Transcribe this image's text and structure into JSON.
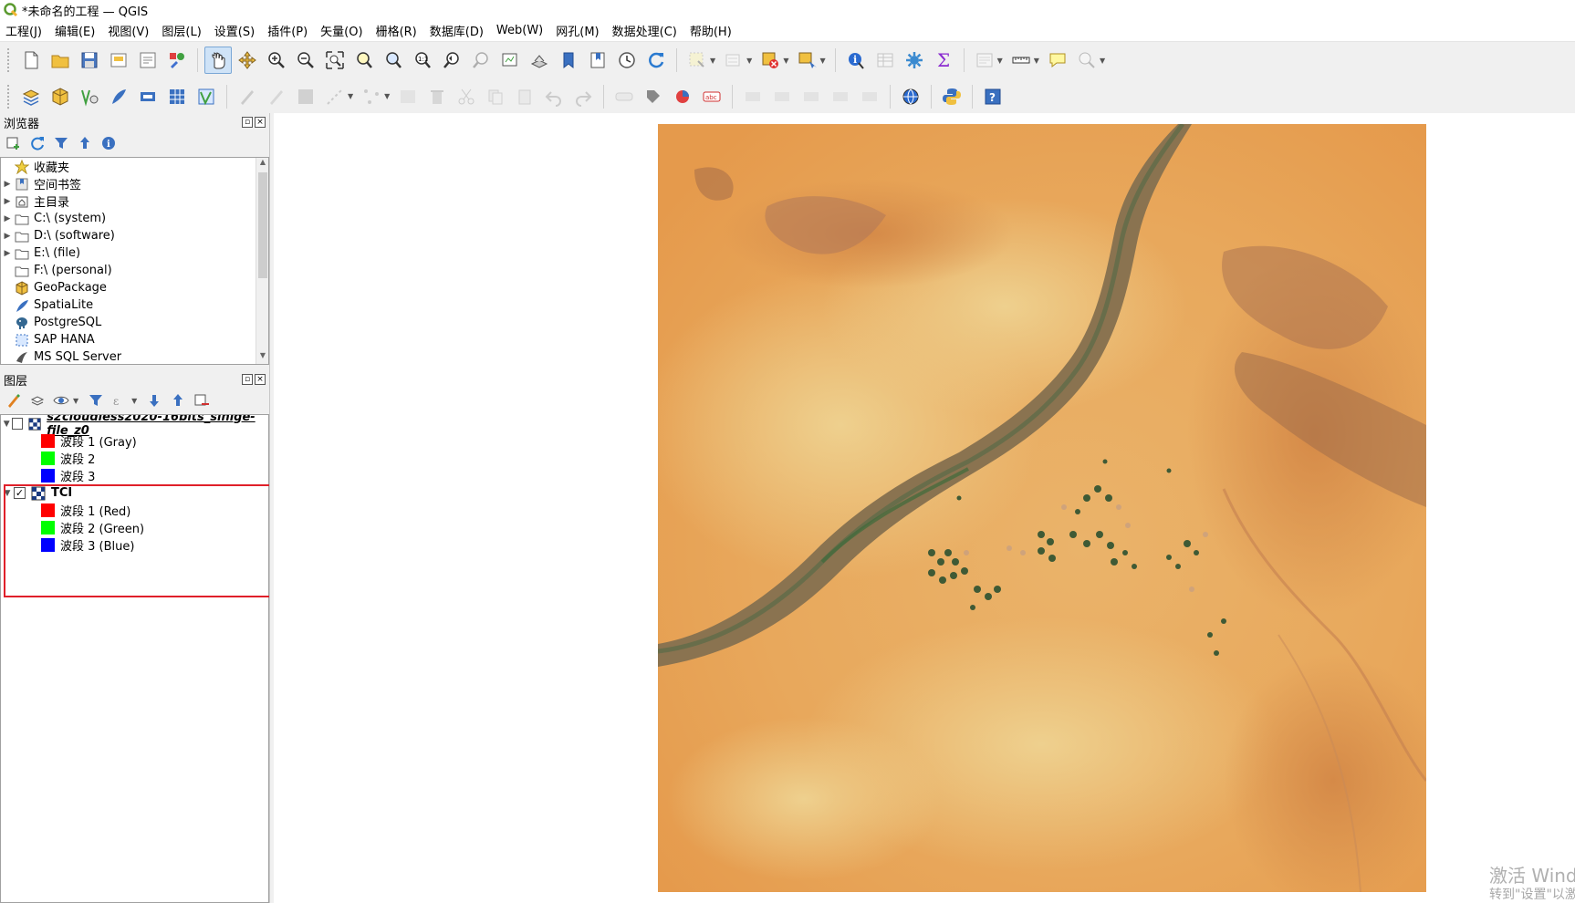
{
  "window": {
    "title": "*未命名的工程 — QGIS"
  },
  "menubar": [
    "工程(J)",
    "编辑(E)",
    "视图(V)",
    "图层(L)",
    "设置(S)",
    "插件(P)",
    "矢量(O)",
    "栅格(R)",
    "数据库(D)",
    "Web(W)",
    "网孔(M)",
    "数据处理(C)",
    "帮助(H)"
  ],
  "browser": {
    "title": "浏览器",
    "items": [
      {
        "label": "收藏夹",
        "icon": "star-icon",
        "expandable": false
      },
      {
        "label": "空间书签",
        "icon": "bookmark-icon",
        "expandable": true
      },
      {
        "label": "主目录",
        "icon": "home-folder-icon",
        "expandable": true
      },
      {
        "label": "C:\\ (system)",
        "icon": "folder-icon",
        "expandable": true
      },
      {
        "label": "D:\\ (software)",
        "icon": "folder-icon",
        "expandable": true
      },
      {
        "label": "E:\\ (file)",
        "icon": "folder-icon",
        "expandable": true
      },
      {
        "label": "F:\\ (personal)",
        "icon": "folder-icon",
        "expandable": false
      },
      {
        "label": "GeoPackage",
        "icon": "geopackage-icon",
        "expandable": false
      },
      {
        "label": "SpatiaLite",
        "icon": "spatialite-icon",
        "expandable": false
      },
      {
        "label": "PostgreSQL",
        "icon": "postgresql-icon",
        "expandable": false
      },
      {
        "label": "SAP HANA",
        "icon": "sap-hana-icon",
        "expandable": false
      },
      {
        "label": "MS SQL Server",
        "icon": "mssql-icon",
        "expandable": false
      }
    ]
  },
  "layers": {
    "title": "图层",
    "items": [
      {
        "name": "s2cloudless2020-16bits_sinlge-file_z0",
        "checked": false,
        "bands": [
          {
            "label": "波段 1 (Gray)",
            "color": "#ff0000"
          },
          {
            "label": "波段 2",
            "color": "#00ff00"
          },
          {
            "label": "波段 3",
            "color": "#0000ff"
          }
        ]
      },
      {
        "name": "TCI",
        "checked": true,
        "bands": [
          {
            "label": "波段 1 (Red)",
            "color": "#ff0000"
          },
          {
            "label": "波段 2 (Green)",
            "color": "#00ff00"
          },
          {
            "label": "波段 3 (Blue)",
            "color": "#0000ff"
          }
        ]
      }
    ]
  },
  "watermark": {
    "line1": "激活 Wind",
    "line2": "转到\"设置\"以激"
  },
  "colors": {
    "highlight": "#e0202a",
    "desert": "#e8a860",
    "river": "#7a6a4a"
  }
}
